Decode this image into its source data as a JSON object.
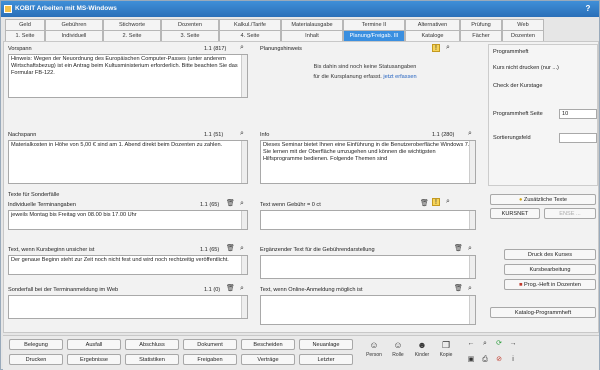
{
  "window": {
    "title": "KOBIT Arbeiten mit MS-Windows",
    "help": "?"
  },
  "tabs_row1": [
    {
      "label": "Geld"
    },
    {
      "label": "Gebühren"
    },
    {
      "label": "Stichworte"
    },
    {
      "label": "Dozenten"
    },
    {
      "label": "Kalkul./Tarife"
    },
    {
      "label": "Materialausgabe"
    },
    {
      "label": "Termine II"
    },
    {
      "label": "Alternativen"
    },
    {
      "label": "Prüfung"
    },
    {
      "label": "Web"
    }
  ],
  "tabs_row2": [
    {
      "label": "1. Seite"
    },
    {
      "label": "Individuell"
    },
    {
      "label": "2. Seite"
    },
    {
      "label": "3. Seite"
    },
    {
      "label": "4. Seite"
    },
    {
      "label": "Inhalt"
    },
    {
      "label": "Planung/Freigab. III",
      "active": true
    },
    {
      "label": "Kataloge"
    },
    {
      "label": "Fächer"
    },
    {
      "label": "Dozenten"
    }
  ],
  "vorspann": {
    "label": "Vorspann",
    "count": "1.1 (817)",
    "text": "Hinweis: Wegen der Neuordnung des Europäischen Computer-Passes (unter anderem Wirtschaftsbezug) ist ein Antrag beim Kultusministerium erforderlich. Bitte beachten Sie das Formular FB-122."
  },
  "nachspann": {
    "label": "Nachspann",
    "count": "1.1 (51)",
    "text": "Materialkosten in Höhe von 5,00 € sind am 1. Abend direkt beim Dozenten zu zahlen."
  },
  "planungshinweis": {
    "label": "Planungshinweis",
    "line1": "Bis dahin sind noch keine Statusangaben",
    "line2": "für die Kursplanung erfasst.",
    "link": "jetzt erfassen"
  },
  "info": {
    "label": "Info",
    "count": "1.1 (280)",
    "text": "Dieses Seminar bietet Ihnen eine Einführung in die Benutzeroberfläche Windows 7. Sie lernen mit der Oberfläche umzugehen und können die wichtigsten Hilfsprogramme bedienen. Folgende Themen sind"
  },
  "texte_label": "Texte für Sonderfälle",
  "terminangaben": {
    "label": "Individuelle Terminangaben",
    "count": "1.1 (65)",
    "text": "jeweils Montag bis Freitag von 08.00 bis 17.00 Uhr"
  },
  "texte_gebuehr": {
    "label": "Text wenn Gebühr = 0 ct"
  },
  "kursbeginn": {
    "label": "Text, wenn Kursbeginn unsicher ist",
    "count": "1.1 (65)",
    "text": "Der genaue Beginn steht zur Zeit noch nicht fest und wird noch rechtzeitig veröffentlicht."
  },
  "ergaenzender": {
    "label": "Ergänzender Text für die Gebührendarstellung"
  },
  "sonderfall_termin": {
    "label": "Sonderfall bei der Terminanmeldung im Web",
    "count": "1.1 (0)"
  },
  "online_anmeldung": {
    "label": "Text, wenn Online-Anmeldung möglich ist"
  },
  "programmheft": {
    "label": "Programmheft",
    "kurs_label": "Kurs nicht drucken (nur ...)",
    "check_label": "Check der Kurstage",
    "seite_label": "Programmheft Seite",
    "seite_value": "10",
    "sortier_label": "Sortierungsfeld",
    "sortier_value": ""
  },
  "side_buttons": {
    "zusaetzliche": "Zusätzliche Texte",
    "kursnet": "KURSNET",
    "extra": "ENSE ...",
    "druck_kurs": "Druck des Kurses",
    "kurs_bearbeitung": "Kursbearbeitung",
    "prog_heft": "Prog.-Heft in Dozenten",
    "katalog": "Katalog-Programmheft"
  },
  "bottom_row1": [
    "Belegung",
    "Ausfall",
    "Abschluss",
    "Dokument",
    "Bescheiden",
    "Neuanlage"
  ],
  "bottom_row2": [
    "Drucken",
    "Ergebnisse",
    "Statistiken",
    "Freigaben",
    "Verträge",
    "Letzter"
  ],
  "bottom_icons": [
    {
      "label": "Person",
      "icon": "person-icon"
    },
    {
      "label": "Rolle",
      "icon": "role-icon"
    },
    {
      "label": "Kinder",
      "icon": "children-icon"
    },
    {
      "label": "Kopie",
      "icon": "copy-icon"
    }
  ]
}
